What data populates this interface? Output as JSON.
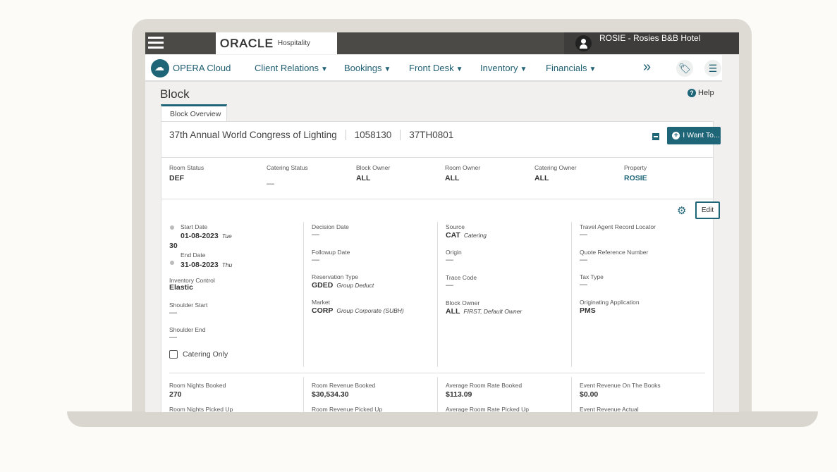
{
  "topbar": {
    "brand": "ORACLE",
    "brand_sub": "Hospitality",
    "user": "ROSIE - Rosies B&B Hotel"
  },
  "nav": {
    "app": "OPERA Cloud",
    "items": [
      "Client Relations",
      "Bookings",
      "Front Desk",
      "Inventory",
      "Financials"
    ],
    "more": "»"
  },
  "page": {
    "title": "Block",
    "help": "Help",
    "tab": "Block Overview"
  },
  "block": {
    "name": "37th Annual World Congress of Lighting",
    "id": "1058130",
    "code": "37TH0801",
    "i_want_to": "I Want To...",
    "edit": "Edit"
  },
  "summary": [
    {
      "label": "Room Status",
      "value": "DEF"
    },
    {
      "label": "Catering Status",
      "value": "—"
    },
    {
      "label": "Block Owner",
      "value": "ALL"
    },
    {
      "label": "Room Owner",
      "value": "ALL"
    },
    {
      "label": "Catering Owner",
      "value": "ALL"
    },
    {
      "label": "Property",
      "value": "ROSIE"
    }
  ],
  "dates": {
    "start_label": "Start Date",
    "start": "01-08-2023",
    "start_day": "Tue",
    "nights": "30",
    "end_label": "End Date",
    "end": "31-08-2023",
    "end_day": "Thu"
  },
  "col1": [
    {
      "label": "Inventory Control",
      "value": "Elastic"
    },
    {
      "label": "Shoulder Start",
      "value": "—"
    },
    {
      "label": "Shoulder End",
      "value": "—"
    }
  ],
  "catering_only": "Catering Only",
  "col2": [
    {
      "label": "Decision Date",
      "value": "—",
      "desc": ""
    },
    {
      "label": "Followup Date",
      "value": "—",
      "desc": ""
    },
    {
      "label": "Reservation Type",
      "value": "GDED",
      "desc": "Group Deduct"
    },
    {
      "label": "Market",
      "value": "CORP",
      "desc": "Group Corporate (SUBH)"
    }
  ],
  "col3": [
    {
      "label": "Source",
      "value": "CAT",
      "desc": "Catering"
    },
    {
      "label": "Origin",
      "value": "—",
      "desc": ""
    },
    {
      "label": "Trace Code",
      "value": "—",
      "desc": ""
    },
    {
      "label": "Block Owner",
      "value": "ALL",
      "desc": "FIRST, Default Owner"
    }
  ],
  "col4": [
    {
      "label": "Travel Agent Record Locator",
      "value": "—"
    },
    {
      "label": "Quote Reference Number",
      "value": "—"
    },
    {
      "label": "Tax Type",
      "value": "—"
    },
    {
      "label": "Originating Application",
      "value": "PMS"
    }
  ],
  "stats": [
    {
      "label": "Room Nights Booked",
      "value": "270",
      "label2": "Room Nights Picked Up"
    },
    {
      "label": "Room Revenue Booked",
      "value": "$30,534.30",
      "label2": "Room Revenue Picked Up"
    },
    {
      "label": "Average Room Rate Booked",
      "value": "$113.09",
      "label2": "Average Room Rate Picked Up"
    },
    {
      "label": "Event Revenue On The Books",
      "value": "$0.00",
      "label2": "Event Revenue Actual"
    }
  ],
  "colors": {
    "accent": "#1d6577",
    "topbar": "#4b4a47"
  }
}
